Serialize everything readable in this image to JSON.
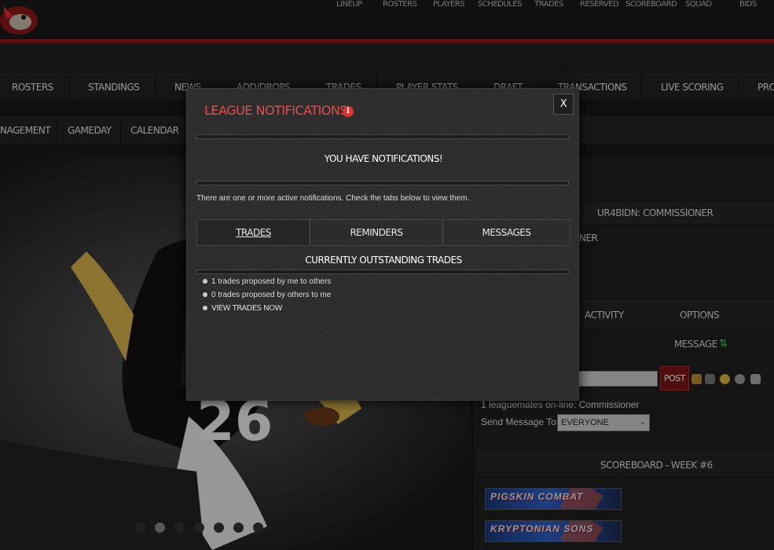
{
  "topbar": {
    "links": [
      "LINEUP",
      "ROSTERS",
      "PLAYERS",
      "SCHEDULES",
      "TRADES",
      "RESERVED",
      "SCOREBOARD",
      "SQUAD",
      "BIDS"
    ]
  },
  "nav_primary": [
    "ROSTERS",
    "STANDINGS",
    "NEWS",
    "ADD/DROPS",
    "TRADES",
    "PLAYER STATS",
    "DRAFT",
    "TRANSACTIONS",
    "LIVE SCORING",
    "PRO"
  ],
  "nav_secondary": [
    "NAGEMENT",
    "GAMEDAY",
    "CALENDAR"
  ],
  "right_panel": {
    "user_title": "UR4BIDN: COMMISSIONER",
    "partial_text": "NER",
    "tabs": [
      "ACTIVITY",
      "OPTIONS"
    ],
    "message_label": "MESSAGE",
    "post_label": "POST",
    "online_text": "1 leaguemates on-line: Commissioner",
    "send_label": "Send Message To:",
    "send_value": "EVERYONE",
    "scoreboard_title": "SCOREBOARD - WEEK #6",
    "banners": [
      "PIGSKIN COMBAT",
      "KRYPTONIAN SONS"
    ]
  },
  "modal": {
    "title": "LEAGUE NOTIFICATIONS",
    "close_label": "X",
    "heading": "YOU HAVE NOTIFICATIONS!",
    "description": "There are one or more active notifications. Check the tabs below to view them.",
    "tabs": [
      "TRADES",
      "REMINDERS",
      "MESSAGES"
    ],
    "section_title": "CURRENTLY OUTSTANDING TRADES",
    "lines": [
      "1 trades proposed by me to others",
      "0 trades proposed by others to me",
      "VIEW TRADES NOW"
    ]
  },
  "colors": {
    "accent_red": "#e74b4b",
    "header_red": "#b21c1c",
    "post_button": "#7a1414"
  }
}
